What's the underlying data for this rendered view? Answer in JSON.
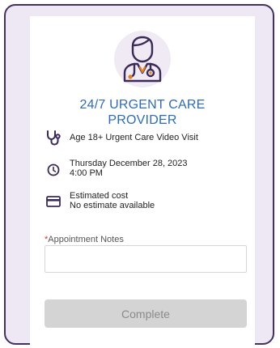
{
  "provider": {
    "title_line1": "24/7 URGENT CARE",
    "title_line2": "PROVIDER",
    "avatar_icon": "doctor-icon"
  },
  "details": {
    "visit_type": "Age 18+ Urgent Care Video Visit",
    "date": "Thursday December 28, 2023",
    "time": "4:00 PM",
    "cost_label": "Estimated cost",
    "cost_value": "No estimate available"
  },
  "notes": {
    "required_marker": "*",
    "label": "Appointment Notes",
    "value": ""
  },
  "actions": {
    "complete_label": "Complete"
  },
  "colors": {
    "frame_border": "#45305f",
    "frame_bg": "#ede8f4",
    "title": "#2f6bb3",
    "icon": "#3b2a57",
    "button_bg": "#d4d4d4"
  }
}
